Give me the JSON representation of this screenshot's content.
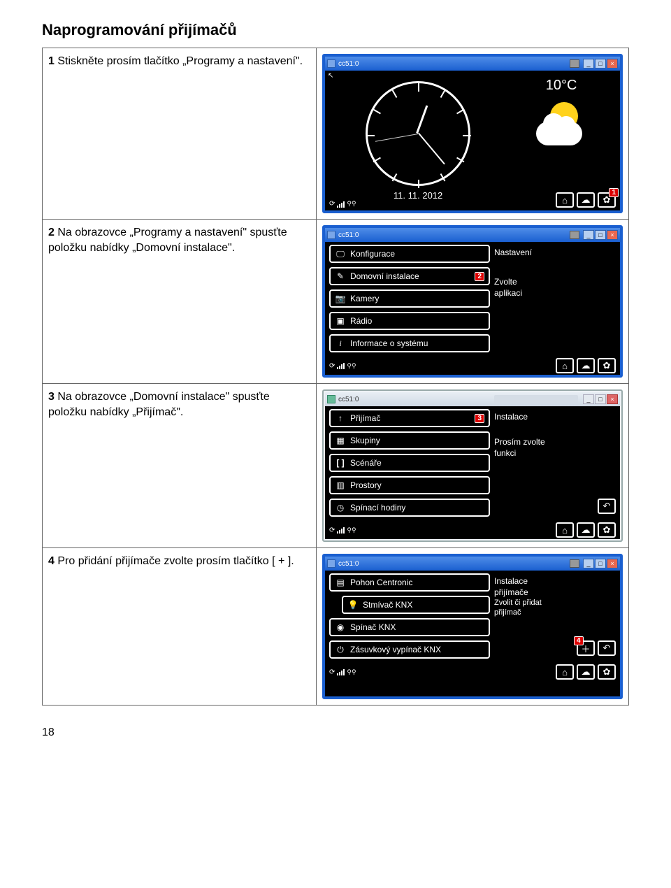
{
  "page_title": "Naprogramování přijímačů",
  "step1": {
    "num": "1",
    "text": "Stiskněte prosím tlačítko „Programy a nastavení\".",
    "window_title": "cc51:0",
    "temp": "10°C",
    "date": "11. 11. 2012",
    "badge": "1"
  },
  "step2": {
    "num": "2",
    "text": "Na obrazovce „Programy a nastavení\" spusťte položku nabídky „Domovní instalace\".",
    "window_title": "cc51:0",
    "menu": {
      "konfigurace": "Konfigurace",
      "domovni": "Domovní instalace",
      "kamery": "Kamery",
      "radio": "Rádio",
      "info": "Informace o systému"
    },
    "side": {
      "nastaveni": "Nastavení",
      "zvolte": "Zvolte",
      "aplikaci": "aplikaci"
    },
    "badge": "2"
  },
  "step3": {
    "num": "3",
    "text": "Na obrazovce „Domovní instalace\" spusťte položku nabídky „Přijímač\".",
    "window_title": "cc51:0",
    "menu": {
      "prijimac": "Přijímač",
      "skupiny": "Skupiny",
      "scenare": "Scénáře",
      "prostory": "Prostory",
      "spinaci": "Spínací hodiny"
    },
    "side": {
      "instalace": "Instalace",
      "prosim": "Prosím zvolte",
      "funkci": "funkci"
    },
    "badge": "3"
  },
  "step4": {
    "num": "4",
    "text": "Pro přidání přijímače zvolte prosím tlačítko [ + ].",
    "window_title": "cc51:0",
    "menu": {
      "pohon": "Pohon Centronic",
      "stmivac": "Stmívač KNX",
      "spinac": "Spínač KNX",
      "zasuv": "Zásuvkový vypínač KNX"
    },
    "side": {
      "l1": "Instalace",
      "l2": "přijímače",
      "l3": "Zvolit či přidat",
      "l4": "přijímač"
    },
    "badge": "4"
  },
  "footer_page": "18"
}
